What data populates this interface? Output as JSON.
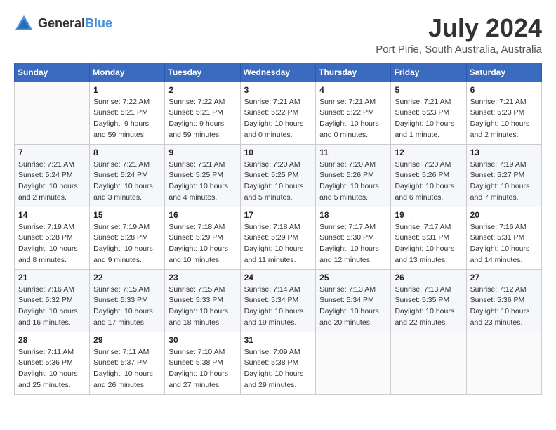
{
  "header": {
    "logo_general": "General",
    "logo_blue": "Blue",
    "month_year": "July 2024",
    "location": "Port Pirie, South Australia, Australia"
  },
  "weekdays": [
    "Sunday",
    "Monday",
    "Tuesday",
    "Wednesday",
    "Thursday",
    "Friday",
    "Saturday"
  ],
  "weeks": [
    [
      {
        "day": "",
        "sunrise": "",
        "sunset": "",
        "daylight": ""
      },
      {
        "day": "1",
        "sunrise": "Sunrise: 7:22 AM",
        "sunset": "Sunset: 5:21 PM",
        "daylight": "Daylight: 9 hours and 59 minutes."
      },
      {
        "day": "2",
        "sunrise": "Sunrise: 7:22 AM",
        "sunset": "Sunset: 5:21 PM",
        "daylight": "Daylight: 9 hours and 59 minutes."
      },
      {
        "day": "3",
        "sunrise": "Sunrise: 7:21 AM",
        "sunset": "Sunset: 5:22 PM",
        "daylight": "Daylight: 10 hours and 0 minutes."
      },
      {
        "day": "4",
        "sunrise": "Sunrise: 7:21 AM",
        "sunset": "Sunset: 5:22 PM",
        "daylight": "Daylight: 10 hours and 0 minutes."
      },
      {
        "day": "5",
        "sunrise": "Sunrise: 7:21 AM",
        "sunset": "Sunset: 5:23 PM",
        "daylight": "Daylight: 10 hours and 1 minute."
      },
      {
        "day": "6",
        "sunrise": "Sunrise: 7:21 AM",
        "sunset": "Sunset: 5:23 PM",
        "daylight": "Daylight: 10 hours and 2 minutes."
      }
    ],
    [
      {
        "day": "7",
        "sunrise": "Sunrise: 7:21 AM",
        "sunset": "Sunset: 5:24 PM",
        "daylight": "Daylight: 10 hours and 2 minutes."
      },
      {
        "day": "8",
        "sunrise": "Sunrise: 7:21 AM",
        "sunset": "Sunset: 5:24 PM",
        "daylight": "Daylight: 10 hours and 3 minutes."
      },
      {
        "day": "9",
        "sunrise": "Sunrise: 7:21 AM",
        "sunset": "Sunset: 5:25 PM",
        "daylight": "Daylight: 10 hours and 4 minutes."
      },
      {
        "day": "10",
        "sunrise": "Sunrise: 7:20 AM",
        "sunset": "Sunset: 5:25 PM",
        "daylight": "Daylight: 10 hours and 5 minutes."
      },
      {
        "day": "11",
        "sunrise": "Sunrise: 7:20 AM",
        "sunset": "Sunset: 5:26 PM",
        "daylight": "Daylight: 10 hours and 5 minutes."
      },
      {
        "day": "12",
        "sunrise": "Sunrise: 7:20 AM",
        "sunset": "Sunset: 5:26 PM",
        "daylight": "Daylight: 10 hours and 6 minutes."
      },
      {
        "day": "13",
        "sunrise": "Sunrise: 7:19 AM",
        "sunset": "Sunset: 5:27 PM",
        "daylight": "Daylight: 10 hours and 7 minutes."
      }
    ],
    [
      {
        "day": "14",
        "sunrise": "Sunrise: 7:19 AM",
        "sunset": "Sunset: 5:28 PM",
        "daylight": "Daylight: 10 hours and 8 minutes."
      },
      {
        "day": "15",
        "sunrise": "Sunrise: 7:19 AM",
        "sunset": "Sunset: 5:28 PM",
        "daylight": "Daylight: 10 hours and 9 minutes."
      },
      {
        "day": "16",
        "sunrise": "Sunrise: 7:18 AM",
        "sunset": "Sunset: 5:29 PM",
        "daylight": "Daylight: 10 hours and 10 minutes."
      },
      {
        "day": "17",
        "sunrise": "Sunrise: 7:18 AM",
        "sunset": "Sunset: 5:29 PM",
        "daylight": "Daylight: 10 hours and 11 minutes."
      },
      {
        "day": "18",
        "sunrise": "Sunrise: 7:17 AM",
        "sunset": "Sunset: 5:30 PM",
        "daylight": "Daylight: 10 hours and 12 minutes."
      },
      {
        "day": "19",
        "sunrise": "Sunrise: 7:17 AM",
        "sunset": "Sunset: 5:31 PM",
        "daylight": "Daylight: 10 hours and 13 minutes."
      },
      {
        "day": "20",
        "sunrise": "Sunrise: 7:16 AM",
        "sunset": "Sunset: 5:31 PM",
        "daylight": "Daylight: 10 hours and 14 minutes."
      }
    ],
    [
      {
        "day": "21",
        "sunrise": "Sunrise: 7:16 AM",
        "sunset": "Sunset: 5:32 PM",
        "daylight": "Daylight: 10 hours and 16 minutes."
      },
      {
        "day": "22",
        "sunrise": "Sunrise: 7:15 AM",
        "sunset": "Sunset: 5:33 PM",
        "daylight": "Daylight: 10 hours and 17 minutes."
      },
      {
        "day": "23",
        "sunrise": "Sunrise: 7:15 AM",
        "sunset": "Sunset: 5:33 PM",
        "daylight": "Daylight: 10 hours and 18 minutes."
      },
      {
        "day": "24",
        "sunrise": "Sunrise: 7:14 AM",
        "sunset": "Sunset: 5:34 PM",
        "daylight": "Daylight: 10 hours and 19 minutes."
      },
      {
        "day": "25",
        "sunrise": "Sunrise: 7:13 AM",
        "sunset": "Sunset: 5:34 PM",
        "daylight": "Daylight: 10 hours and 20 minutes."
      },
      {
        "day": "26",
        "sunrise": "Sunrise: 7:13 AM",
        "sunset": "Sunset: 5:35 PM",
        "daylight": "Daylight: 10 hours and 22 minutes."
      },
      {
        "day": "27",
        "sunrise": "Sunrise: 7:12 AM",
        "sunset": "Sunset: 5:36 PM",
        "daylight": "Daylight: 10 hours and 23 minutes."
      }
    ],
    [
      {
        "day": "28",
        "sunrise": "Sunrise: 7:11 AM",
        "sunset": "Sunset: 5:36 PM",
        "daylight": "Daylight: 10 hours and 25 minutes."
      },
      {
        "day": "29",
        "sunrise": "Sunrise: 7:11 AM",
        "sunset": "Sunset: 5:37 PM",
        "daylight": "Daylight: 10 hours and 26 minutes."
      },
      {
        "day": "30",
        "sunrise": "Sunrise: 7:10 AM",
        "sunset": "Sunset: 5:38 PM",
        "daylight": "Daylight: 10 hours and 27 minutes."
      },
      {
        "day": "31",
        "sunrise": "Sunrise: 7:09 AM",
        "sunset": "Sunset: 5:38 PM",
        "daylight": "Daylight: 10 hours and 29 minutes."
      },
      {
        "day": "",
        "sunrise": "",
        "sunset": "",
        "daylight": ""
      },
      {
        "day": "",
        "sunrise": "",
        "sunset": "",
        "daylight": ""
      },
      {
        "day": "",
        "sunrise": "",
        "sunset": "",
        "daylight": ""
      }
    ]
  ]
}
